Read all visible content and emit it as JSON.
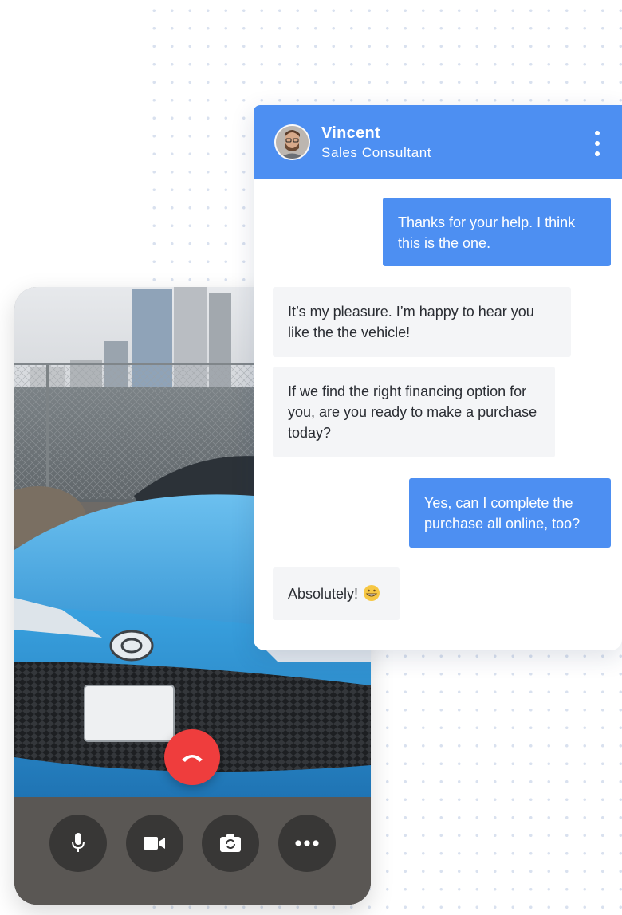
{
  "agent": {
    "name": "Vincent",
    "role": "Sales Consultant"
  },
  "messages": [
    {
      "sender": "user",
      "text": "Thanks for your help. I think this is the one."
    },
    {
      "sender": "agent",
      "text": "It’s my pleasure. I’m happy to hear you like the the vehicle!"
    },
    {
      "sender": "agent",
      "text": "If we find the right financing option for you, are you ready to make a purchase today?"
    },
    {
      "sender": "user",
      "text": "Yes, can I complete the purchase all online, too?"
    },
    {
      "sender": "agent",
      "text": "Absolutely!",
      "emoji": "grinning-face-emoji"
    }
  ],
  "call_controls": {
    "end_call_icon": "phone-hangup-icon",
    "microphone_icon": "microphone-icon",
    "camera_icon": "video-camera-icon",
    "switch_camera_icon": "switch-camera-icon",
    "more_icon": "more-horizontal-icon"
  },
  "colors": {
    "accent_blue": "#4d8ff2",
    "end_call_red": "#ef3d3d",
    "incoming_bubble": "#f4f5f7",
    "car_blue": "#3fa3e0"
  }
}
